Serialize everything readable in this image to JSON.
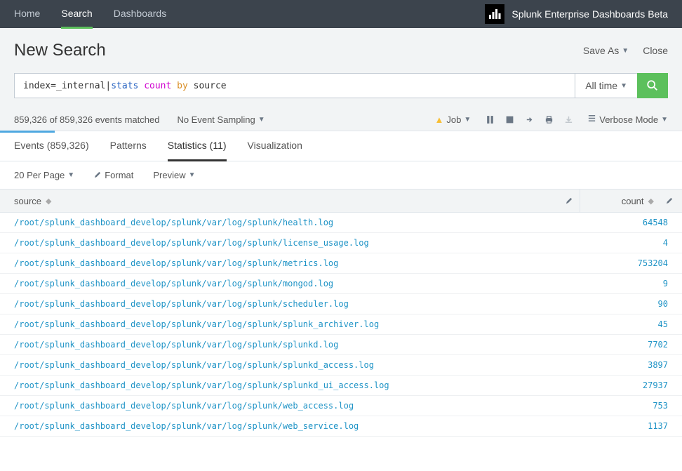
{
  "nav": {
    "items": [
      "Home",
      "Search",
      "Dashboards"
    ],
    "active": 1,
    "app_title": "Splunk Enterprise Dashboards Beta"
  },
  "header": {
    "title": "New Search",
    "save_as": "Save As",
    "close": "Close"
  },
  "search": {
    "prefix": "index=_internal| ",
    "cmd": "stats",
    "func": "count",
    "by": "by",
    "arg": "source",
    "time_label": "All time"
  },
  "jobbar": {
    "events_text": "859,326 of 859,326 events matched",
    "sampling": "No Event Sampling",
    "job_label": "Job",
    "mode": "Verbose Mode"
  },
  "tabs": {
    "items": [
      "Events (859,326)",
      "Patterns",
      "Statistics (11)",
      "Visualization"
    ],
    "active": 2
  },
  "toolbar": {
    "per_page": "20 Per Page",
    "format": "Format",
    "preview": "Preview"
  },
  "table": {
    "col_source": "source",
    "col_count": "count",
    "rows": [
      {
        "source": "/root/splunk_dashboard_develop/splunk/var/log/splunk/health.log",
        "count": "64548"
      },
      {
        "source": "/root/splunk_dashboard_develop/splunk/var/log/splunk/license_usage.log",
        "count": "4"
      },
      {
        "source": "/root/splunk_dashboard_develop/splunk/var/log/splunk/metrics.log",
        "count": "753204"
      },
      {
        "source": "/root/splunk_dashboard_develop/splunk/var/log/splunk/mongod.log",
        "count": "9"
      },
      {
        "source": "/root/splunk_dashboard_develop/splunk/var/log/splunk/scheduler.log",
        "count": "90"
      },
      {
        "source": "/root/splunk_dashboard_develop/splunk/var/log/splunk/splunk_archiver.log",
        "count": "45"
      },
      {
        "source": "/root/splunk_dashboard_develop/splunk/var/log/splunk/splunkd.log",
        "count": "7702"
      },
      {
        "source": "/root/splunk_dashboard_develop/splunk/var/log/splunk/splunkd_access.log",
        "count": "3897"
      },
      {
        "source": "/root/splunk_dashboard_develop/splunk/var/log/splunk/splunkd_ui_access.log",
        "count": "27937"
      },
      {
        "source": "/root/splunk_dashboard_develop/splunk/var/log/splunk/web_access.log",
        "count": "753"
      },
      {
        "source": "/root/splunk_dashboard_develop/splunk/var/log/splunk/web_service.log",
        "count": "1137"
      }
    ]
  }
}
